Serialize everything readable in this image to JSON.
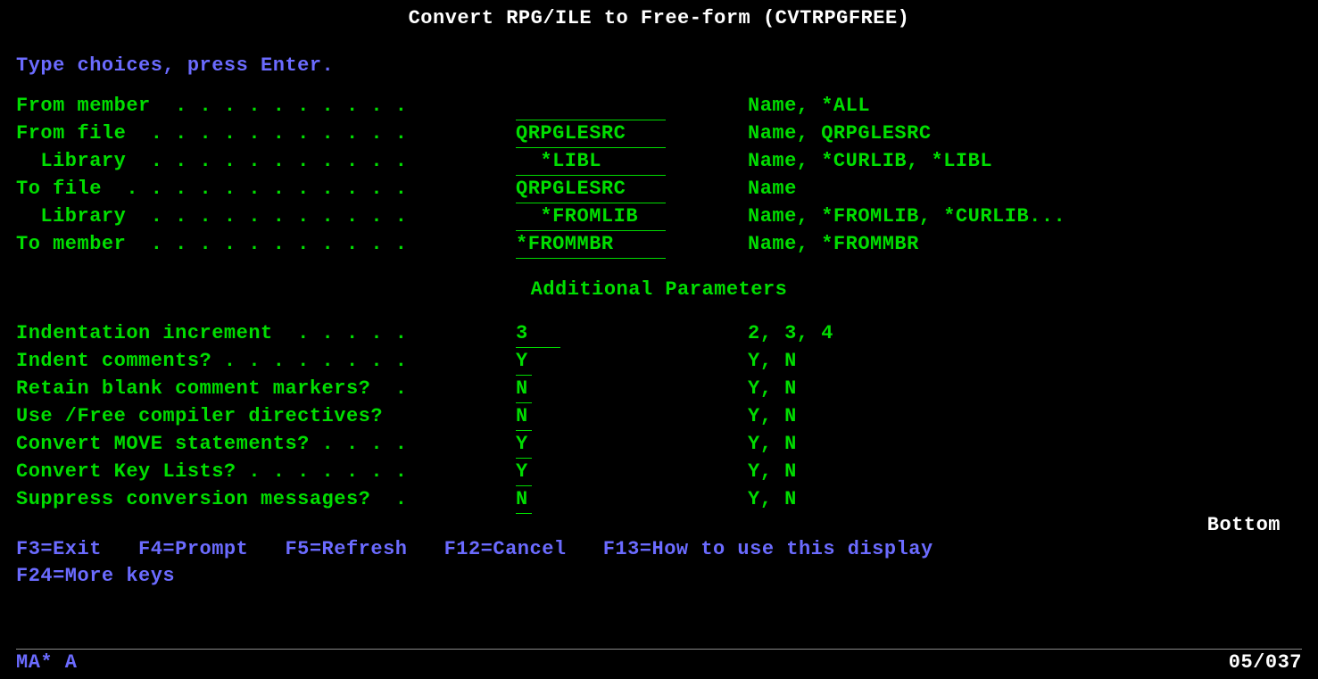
{
  "title": "Convert RPG/ILE to Free-form (CVTRPGFREE)",
  "instruction": "Type choices, press Enter.",
  "fields": {
    "from_member": {
      "label": "From member  . . . . . . . . . .",
      "value": "          ",
      "hint": "Name, *ALL"
    },
    "from_file": {
      "label": "From file  . . . . . . . . . . .",
      "value": "QRPGLESRC ",
      "hint": "Name, QRPGLESRC"
    },
    "from_lib": {
      "label": "  Library  . . . . . . . . . . .",
      "value": "  *LIBL   ",
      "hint": "Name, *CURLIB, *LIBL"
    },
    "to_file": {
      "label": "To file  . . . . . . . . . . . .",
      "value": "QRPGLESRC ",
      "hint": "Name"
    },
    "to_lib": {
      "label": "  Library  . . . . . . . . . . .",
      "value": "  *FROMLIB",
      "hint": "Name, *FROMLIB, *CURLIB..."
    },
    "to_member": {
      "label": "To member  . . . . . . . . . . .",
      "value": "*FROMMBR  ",
      "hint": "Name, *FROMMBR"
    }
  },
  "additional_heading": "Additional Parameters",
  "additional": {
    "indent_inc": {
      "label": "Indentation increment  . . . . .",
      "value": "3 ",
      "hint": "2, 3, 4"
    },
    "indent_cmt": {
      "label": "Indent comments? . . . . . . . .",
      "value": "Y",
      "hint": "Y, N"
    },
    "retain_blank": {
      "label": "Retain blank comment markers?  .",
      "value": "N",
      "hint": "Y, N"
    },
    "use_free": {
      "label": "Use /Free compiler directives? ",
      "value": "N",
      "hint": "Y, N"
    },
    "conv_move": {
      "label": "Convert MOVE statements? . . . .",
      "value": "Y",
      "hint": "Y, N"
    },
    "conv_key": {
      "label": "Convert Key Lists? . . . . . . .",
      "value": "Y",
      "hint": "Y, N"
    },
    "suppress": {
      "label": "Suppress conversion messages?  .",
      "value": "N",
      "hint": "Y, N"
    }
  },
  "bottom_text": "Bottom",
  "fkeys_line1": "F3=Exit   F4=Prompt   F5=Refresh   F12=Cancel   F13=How to use this display",
  "fkeys_line2": "F24=More keys",
  "status": {
    "left": "MA*   A",
    "right": "05/037"
  }
}
